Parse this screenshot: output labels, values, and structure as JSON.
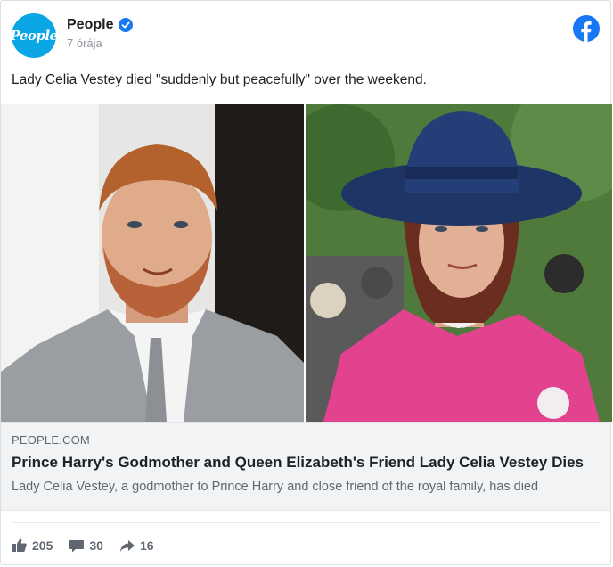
{
  "header": {
    "page_name": "People",
    "avatar_text": "People",
    "timestamp": "7 órája",
    "verified_icon": "verified-badge-icon",
    "platform_icon": "facebook-icon"
  },
  "post": {
    "text": "Lady Celia Vestey died \"suddenly but peacefully\" over the weekend."
  },
  "link": {
    "domain": "PEOPLE.COM",
    "title": "Prince Harry's Godmother and Queen Elizabeth's Friend Lady Celia Vestey Dies",
    "description": "Lady Celia Vestey, a godmother to Prince Harry and close friend of the royal family, has died"
  },
  "reactions": {
    "likes": "205",
    "comments": "30",
    "shares": "16",
    "like_icon": "thumbs-up-icon",
    "comment_icon": "comment-icon",
    "share_icon": "share-arrow-icon"
  },
  "colors": {
    "brand_blue": "#1877f2",
    "avatar_blue": "#0aa6e6",
    "meta_gray": "#606770"
  }
}
